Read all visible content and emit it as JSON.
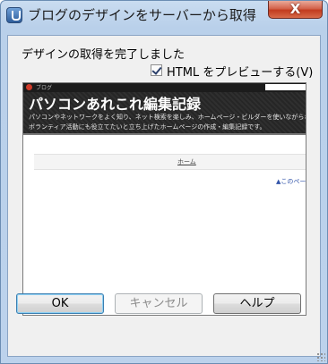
{
  "window": {
    "title": "ブログのデザインをサーバーから取得",
    "close_glyph": "X"
  },
  "dialog": {
    "message": "デザインの取得を完了しました",
    "preview_checkbox_label": "HTML をプレビューする(V)",
    "preview_checkbox_checked": true
  },
  "preview": {
    "blog_tag": "ブログ",
    "blog_title": "パソコンあれこれ編集記録",
    "description_line1": "パソコンやネットワークをよく知り、ネット検索を楽しみ、ホームページ・ビルダーを使いながらホ",
    "description_line2": "ボランティア活動にも役立てたいと立ち上げたホームページの作成・編集記録です。",
    "nav_home": "ホーム",
    "page_link": "▲このペー"
  },
  "buttons": {
    "ok": "OK",
    "cancel": "キャンセル",
    "help": "ヘルプ"
  },
  "colors": {
    "titlebar": "#c9dcf0",
    "close_button": "#c23b1f",
    "banner": "#2b2b2b"
  }
}
